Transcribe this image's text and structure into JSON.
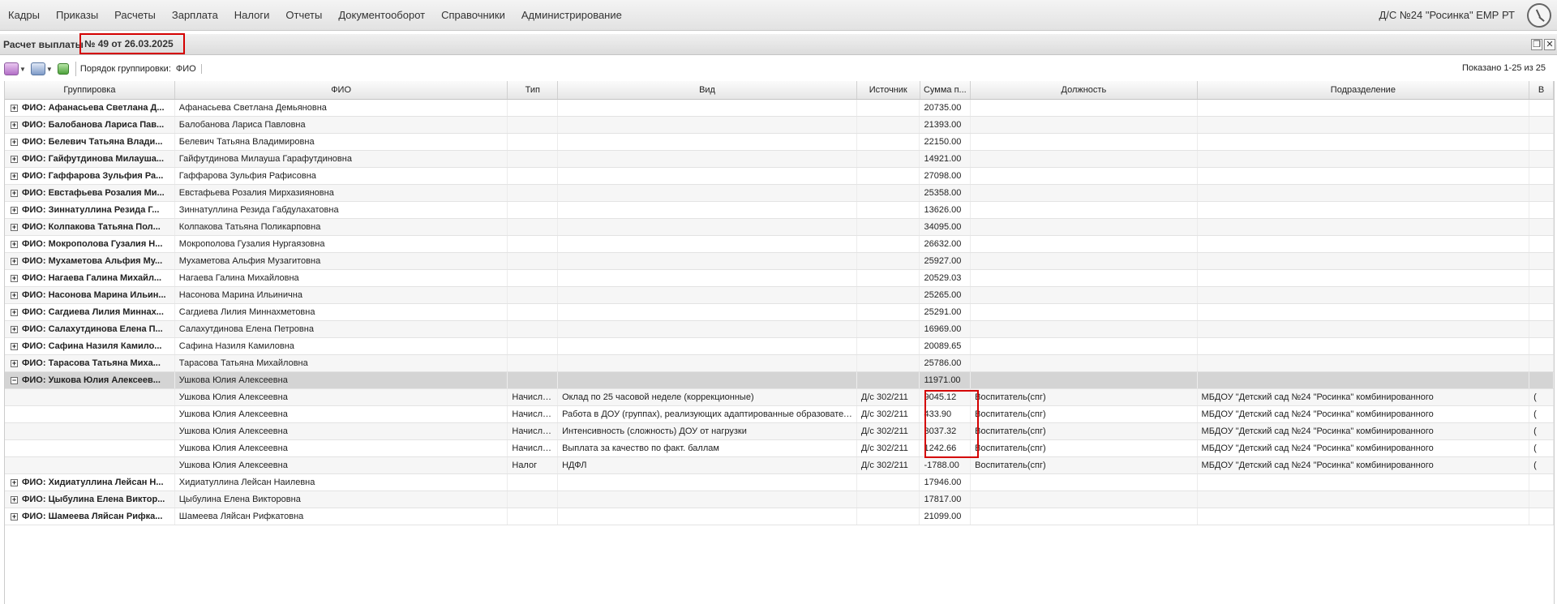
{
  "menu": [
    "Кадры",
    "Приказы",
    "Расчеты",
    "Зарплата",
    "Налоги",
    "Отчеты",
    "Документооборот",
    "Справочники",
    "Администрирование"
  ],
  "org_name": "Д/С №24 \"Росинка\" ЕМР РТ",
  "panel": {
    "title": "Расчет выплаты",
    "number": "№ 49 от 26.03.2025"
  },
  "toolbar": {
    "group_label": "Порядок группировки:",
    "group_value": "ФИО",
    "shown": "Показано 1-25 из 25"
  },
  "columns": [
    "Группировка",
    "ФИО",
    "Тип",
    "Вид",
    "Источник",
    "Сумма п...",
    "Должность",
    "Подразделение",
    "В"
  ],
  "rows": [
    {
      "g": "ФИО: Афанасьева Светлана Д...",
      "fio": "Афанасьева Светлана Демьяновна",
      "sum": "20735.00"
    },
    {
      "g": "ФИО: Балобанова Лариса Пав...",
      "fio": "Балобанова Лариса Павловна",
      "sum": "21393.00"
    },
    {
      "g": "ФИО: Белевич Татьяна Влади...",
      "fio": "Белевич Татьяна Владимировна",
      "sum": "22150.00"
    },
    {
      "g": "ФИО: Гайфутдинова Милауша...",
      "fio": "Гайфутдинова Милауша Гарафутдиновна",
      "sum": "14921.00"
    },
    {
      "g": "ФИО: Гаффарова Зульфия Ра...",
      "fio": "Гаффарова Зульфия Рафисовна",
      "sum": "27098.00"
    },
    {
      "g": "ФИО: Евстафьева Розалия Ми...",
      "fio": "Евстафьева Розалия Мирхазияновна",
      "sum": "25358.00"
    },
    {
      "g": "ФИО: Зиннатуллина Резида Г...",
      "fio": "Зиннатуллина Резида Габдулахатовна",
      "sum": "13626.00"
    },
    {
      "g": "ФИО: Колпакова Татьяна Пол...",
      "fio": "Колпакова Татьяна Поликарповна",
      "sum": "34095.00"
    },
    {
      "g": "ФИО: Мокрополова Гузалия Н...",
      "fio": "Мокрополова Гузалия Нургаязовна",
      "sum": "26632.00"
    },
    {
      "g": "ФИО: Мухаметова Альфия Му...",
      "fio": "Мухаметова Альфия Музагитовна",
      "sum": "25927.00"
    },
    {
      "g": "ФИО: Нагаева Галина Михайл...",
      "fio": "Нагаева Галина Михайловна",
      "sum": "20529.03"
    },
    {
      "g": "ФИО: Насонова Марина Ильин...",
      "fio": "Насонова Марина Ильинична",
      "sum": "25265.00"
    },
    {
      "g": "ФИО: Сагдиева Лилия Миннах...",
      "fio": "Сагдиева Лилия Миннахметовна",
      "sum": "25291.00"
    },
    {
      "g": "ФИО: Салахутдинова Елена П...",
      "fio": "Салахутдинова Елена Петровна",
      "sum": "16969.00"
    },
    {
      "g": "ФИО: Сафина Назиля Камило...",
      "fio": "Сафина Назиля Камиловна",
      "sum": "20089.65"
    },
    {
      "g": "ФИО: Тарасова Татьяна Миха...",
      "fio": "Тарасова Татьяна Михайловна",
      "sum": "25786.00"
    },
    {
      "g": "ФИО: Ушкова Юлия Алексеев...",
      "fio": "Ушкова Юлия Алексеевна",
      "sum": "11971.00",
      "expanded": true
    },
    {
      "fio": "Ушкова Юлия Алексеевна",
      "type": "Начисле...",
      "kind": "Оклад по 25 часовой неделе (коррекционные)",
      "src": "Д/с 302/211",
      "sum": "9045.12",
      "pos": "Воспитатель(спг)",
      "dept": "МБДОУ \"Детский сад №24 \"Росинка\" комбинированного",
      "v": "("
    },
    {
      "fio": "Ушкова Юлия Алексеевна",
      "type": "Начисле...",
      "kind": "Работа в ДОУ (группах), реализующих адаптированные образовател...",
      "src": "Д/с 302/211",
      "sum": "433.90",
      "pos": "Воспитатель(спг)",
      "dept": "МБДОУ \"Детский сад №24 \"Росинка\" комбинированного",
      "v": "("
    },
    {
      "fio": "Ушкова Юлия Алексеевна",
      "type": "Начисле...",
      "kind": "Интенсивность (сложность) ДОУ от нагрузки",
      "src": "Д/с 302/211",
      "sum": "3037.32",
      "pos": "Воспитатель(спг)",
      "dept": "МБДОУ \"Детский сад №24 \"Росинка\" комбинированного",
      "v": "("
    },
    {
      "fio": "Ушкова Юлия Алексеевна",
      "type": "Начисле...",
      "kind": "Выплата за качество по факт. баллам",
      "src": "Д/с 302/211",
      "sum": "1242.66",
      "pos": "Воспитатель(спг)",
      "dept": "МБДОУ \"Детский сад №24 \"Росинка\" комбинированного",
      "v": "("
    },
    {
      "fio": "Ушкова Юлия Алексеевна",
      "type": "Налог",
      "kind": "НДФЛ",
      "src": "Д/с 302/211",
      "sum": "-1788.00",
      "pos": "Воспитатель(спг)",
      "dept": "МБДОУ \"Детский сад №24 \"Росинка\" комбинированного",
      "v": "("
    },
    {
      "g": "ФИО: Хидиатуллина Лейсан Н...",
      "fio": "Хидиатуллина Лейсан Наилевна",
      "sum": "17946.00"
    },
    {
      "g": "ФИО: Цыбулина Елена Виктор...",
      "fio": "Цыбулина Елена Викторовна",
      "sum": "17817.00"
    },
    {
      "g": "ФИО: Шамеева Ляйсан Рифка...",
      "fio": "Шамеева Ляйсан Рифкатовна",
      "sum": "21099.00"
    }
  ]
}
